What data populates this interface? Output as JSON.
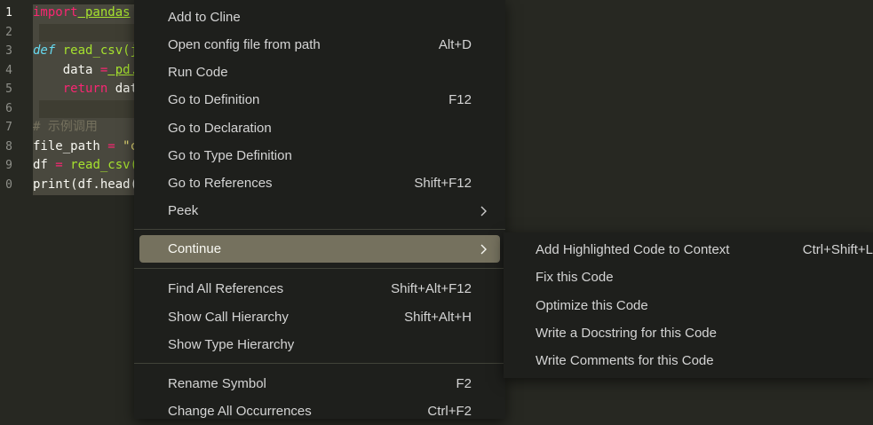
{
  "editor": {
    "line_numbers": [
      "1",
      "2",
      "3",
      "4",
      "5",
      "6",
      "7",
      "8",
      "9",
      "0"
    ],
    "lines": [
      {
        "kw": "import",
        "rest": " pandas"
      },
      {
        "text": ""
      },
      {
        "def": "def",
        "fn": "read_csv(j"
      },
      {
        "pre": "    data ",
        "op": "=",
        "rest": " pd."
      },
      {
        "pre": "    ",
        "kw": "return",
        "rest": " dat"
      },
      {
        "text": ""
      },
      {
        "comment": "# 示例调用"
      },
      {
        "pre": "file_path ",
        "op": "=",
        "str": " \"c"
      },
      {
        "pre": "df ",
        "op": "=",
        "fn": " read_csv("
      },
      {
        "pre": "print(df.head("
      }
    ]
  },
  "menu": {
    "items": [
      {
        "label": "Add to Cline",
        "shortcut": ""
      },
      {
        "label": "Open config file from path",
        "shortcut": "Alt+D"
      },
      {
        "label": "Run Code",
        "shortcut": ""
      },
      {
        "label": "Go to Definition",
        "shortcut": "F12"
      },
      {
        "label": "Go to Declaration",
        "shortcut": ""
      },
      {
        "label": "Go to Type Definition",
        "shortcut": ""
      },
      {
        "label": "Go to References",
        "shortcut": "Shift+F12"
      },
      {
        "label": "Peek",
        "shortcut": ""
      },
      {
        "label": "Continue",
        "shortcut": ""
      },
      {
        "label": "Find All References",
        "shortcut": "Shift+Alt+F12"
      },
      {
        "label": "Show Call Hierarchy",
        "shortcut": "Shift+Alt+H"
      },
      {
        "label": "Show Type Hierarchy",
        "shortcut": ""
      },
      {
        "label": "Rename Symbol",
        "shortcut": "F2"
      },
      {
        "label": "Change All Occurrences",
        "shortcut": "Ctrl+F2"
      }
    ],
    "peek_icon": "chevron-right-icon",
    "continue_icon": "chevron-right-icon"
  },
  "submenu": {
    "items": [
      {
        "label": "Add Highlighted Code to Context",
        "shortcut": "Ctrl+Shift+L"
      },
      {
        "label": "Fix this Code",
        "shortcut": ""
      },
      {
        "label": "Optimize this Code",
        "shortcut": ""
      },
      {
        "label": "Write a Docstring for this Code",
        "shortcut": ""
      },
      {
        "label": "Write Comments for this Code",
        "shortcut": ""
      }
    ]
  },
  "colors": {
    "editor_bg": "#272822",
    "menu_bg": "#1e1f1c",
    "active_item_bg": "#75715e",
    "keyword": "#f92672",
    "function": "#a6e22e",
    "def_keyword": "#66d9ef",
    "comment": "#75715e"
  }
}
